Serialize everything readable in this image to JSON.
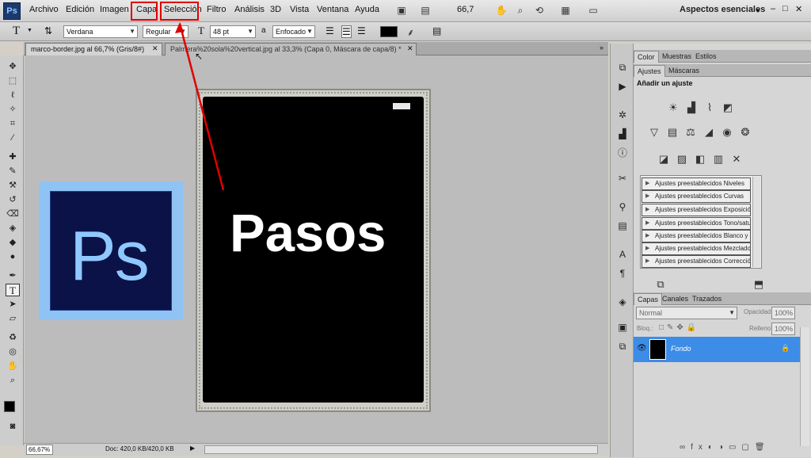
{
  "menubar": {
    "logo": "Ps",
    "menus": [
      "Archivo",
      "Edición",
      "Imagen",
      "Capa",
      "Selección",
      "Filtro",
      "Análisis",
      "3D",
      "Vista",
      "Ventana",
      "Ayuda"
    ],
    "zoom": "66,7",
    "workspace": "Aspectos esenciales"
  },
  "options": {
    "font_family": "Verdana",
    "font_style": "Regular",
    "font_size": "48 pt",
    "aa_label": "a",
    "antialias": "Enfocado"
  },
  "tabs": [
    {
      "label": "marco-border.jpg al 66,7% (Gris/8#)"
    },
    {
      "label": "Palmera%20sola%20vertical.jpg al 33,3% (Capa 0, Máscara de capa/8) *"
    }
  ],
  "canvas": {
    "logo_text": "Ps",
    "overlay_text": "Pasos"
  },
  "status": {
    "zoom": "66,67%",
    "doc": "Doc: 420,0 KB/420,0 KB"
  },
  "panels": {
    "color_tabs": [
      "Color",
      "Muestras",
      "Estilos"
    ],
    "adjust_tabs": [
      "Ajustes",
      "Máscaras"
    ],
    "adjust_title": "Añadir un ajuste",
    "presets": [
      "Ajustes preestablecidos Niveles",
      "Ajustes preestablecidos Curvas",
      "Ajustes preestablecidos Exposición",
      "Ajustes preestablecidos Tono/saturación",
      "Ajustes preestablecidos Blanco y negro",
      "Ajustes preestablecidos Mezclador",
      "Ajustes preestablecidos Corrección"
    ],
    "layer_tabs": [
      "Capas",
      "Canales",
      "Trazados"
    ],
    "blend_mode": "Normal",
    "opacity_label": "Opacidad:",
    "opacity": "100%",
    "lock_label": "Bloq.:",
    "fill_label": "Relleno:",
    "fill": "100%",
    "layer_name": "Fondo"
  },
  "colors": {
    "highlight_red": "#e00000",
    "layer_selected": "#3c8ce8",
    "ps_blue": "#8fc3f4",
    "ps_dark": "#0a1247"
  }
}
